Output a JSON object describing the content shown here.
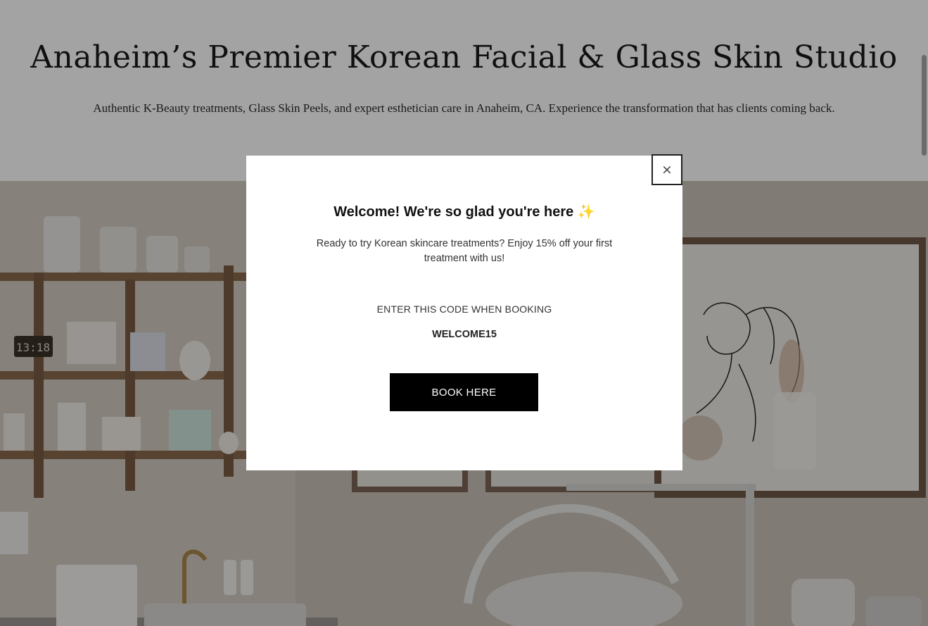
{
  "hero": {
    "title": "Anaheim’s Premier Korean Facial & Glass Skin Studio",
    "subtitle": "Authentic K-Beauty treatments, Glass Skin Peels, and expert esthetician care in Anaheim, CA. Experience the transformation that has clients coming back."
  },
  "photo": {
    "clock_text": "13:18"
  },
  "popup": {
    "close_label": "×",
    "title": "Welcome! We're so glad you're here",
    "title_emoji": "✨",
    "body": "Ready to try Korean skincare treatments? Enjoy 15% off your first treatment with us!",
    "code_label": "ENTER THIS CODE WHEN BOOKING",
    "code": "WELCOME15",
    "cta_label": "BOOK HERE"
  },
  "colors": {
    "cta_background": "#000000",
    "cta_text": "#ffffff",
    "scrim": "rgba(0,0,0,0.36)",
    "sparkle": "#f2c23a"
  }
}
